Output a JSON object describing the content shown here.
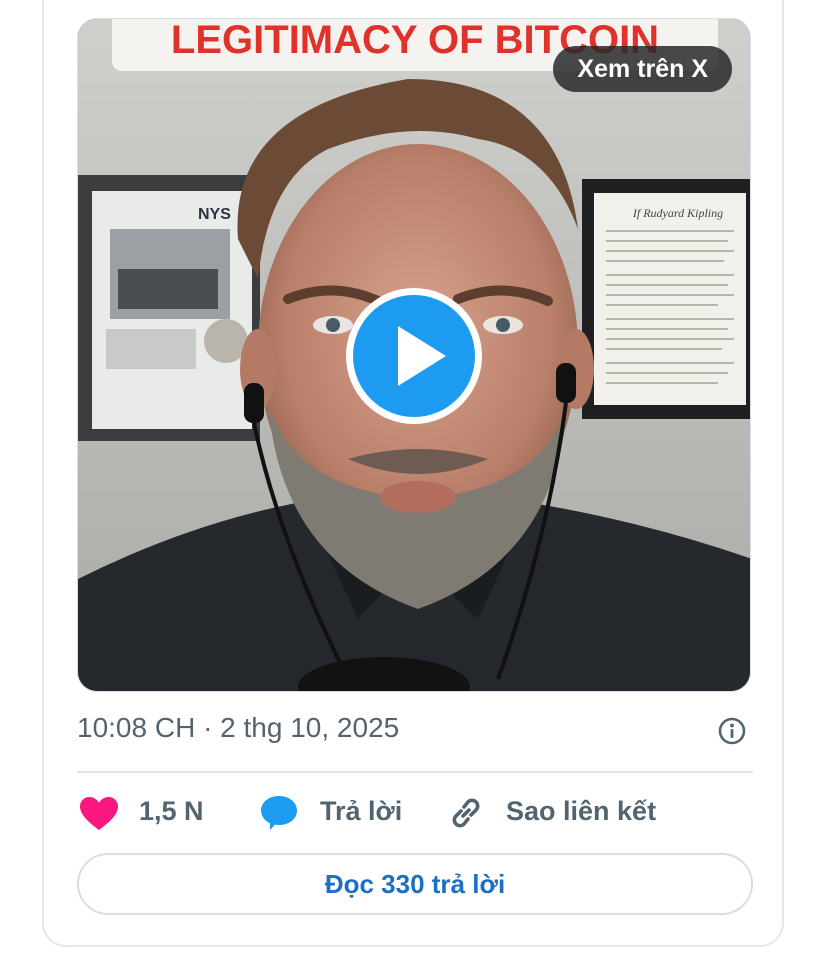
{
  "video": {
    "banner_text": "LEGITIMACY OF BITCOIN",
    "view_on_x_label": "Xem trên X",
    "sign_text": "NYS",
    "poem_title": "If Rudyard Kipling"
  },
  "post": {
    "timestamp": "10:08 CH · 2 thg 10, 2025"
  },
  "actions": {
    "like_count": "1,5 N",
    "reply_label": "Trả lời",
    "copy_link_label": "Sao liên kết"
  },
  "read_replies_label": "Đọc 330 trả lời",
  "colors": {
    "like": "#f91880",
    "reply": "#1d9bf0",
    "play": "#1d9bf0",
    "banner_text": "#e0312b",
    "link": "#1d6fc4"
  },
  "icons": [
    "play-icon",
    "info-icon",
    "heart-icon",
    "reply-bubble-icon",
    "link-icon"
  ]
}
